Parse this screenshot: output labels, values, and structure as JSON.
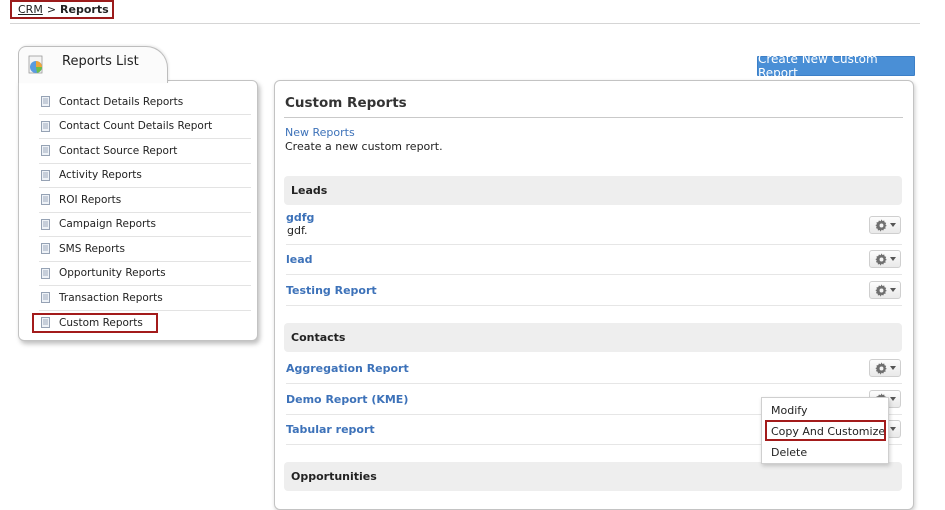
{
  "breadcrumb": {
    "root": "CRM",
    "separator": ">",
    "current": "Reports"
  },
  "sidebar": {
    "tab_title": "Reports List",
    "items": [
      {
        "label": "Contact Details Reports"
      },
      {
        "label": "Contact Count Details Report"
      },
      {
        "label": "Contact Source Report"
      },
      {
        "label": "Activity Reports"
      },
      {
        "label": "ROI Reports"
      },
      {
        "label": "Campaign Reports"
      },
      {
        "label": "SMS Reports"
      },
      {
        "label": "Opportunity Reports"
      },
      {
        "label": "Transaction Reports"
      },
      {
        "label": "Custom Reports"
      }
    ]
  },
  "toolbar": {
    "create_label": "Create New Custom Report"
  },
  "main": {
    "title": "Custom Reports",
    "new_reports": {
      "link": "New Reports",
      "desc": "Create a new custom report."
    },
    "sections": [
      {
        "name": "Leads",
        "reports": [
          {
            "name": "gdfg",
            "desc": "gdf."
          },
          {
            "name": "lead"
          },
          {
            "name": "Testing Report"
          }
        ]
      },
      {
        "name": "Contacts",
        "reports": [
          {
            "name": "Aggregation Report"
          },
          {
            "name": "Demo Report (KME)"
          },
          {
            "name": "Tabular report"
          }
        ]
      },
      {
        "name": "Opportunities",
        "reports": []
      }
    ]
  },
  "dropdown": {
    "items": [
      "Modify",
      "Copy And Customize",
      "Delete"
    ]
  },
  "colors": {
    "link": "#3d72b9",
    "button": "#4a8fd6",
    "highlight": "#a31b1b"
  },
  "icons": {
    "report": "document-icon",
    "tab": "pie-chart-icon",
    "action": "gear-icon"
  }
}
